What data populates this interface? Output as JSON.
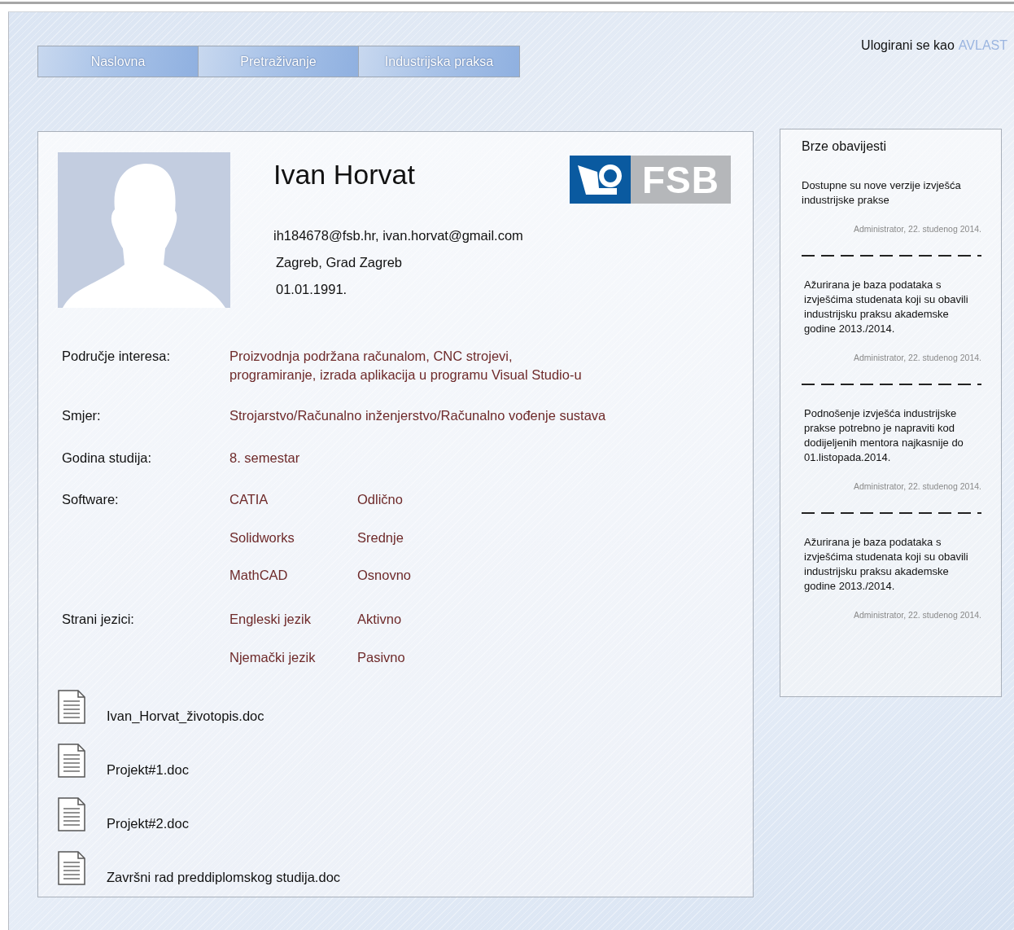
{
  "nav": {
    "tabs": [
      {
        "label": "Naslovna"
      },
      {
        "label": "Pretraživanje"
      },
      {
        "label": "Industrijska praksa"
      }
    ]
  },
  "login": {
    "prefix": "Ulogirani se kao",
    "user": "AVLAST"
  },
  "profile": {
    "name": "Ivan Horvat",
    "logo": "FSB",
    "contacts": [
      "ih184678@fsb.hr, ivan.horvat@gmail.com",
      "Zagreb, Grad Zagreb",
      "01.01.1991."
    ],
    "fields": [
      {
        "label": "Područje interesa:",
        "kind": "text",
        "value": "Proizvodnja podržana računalom, CNC strojevi,\nprogramiranje, izrada aplikacija u programu Visual Studio-u"
      },
      {
        "label": "Smjer:",
        "kind": "text",
        "value": "Strojarstvo/Računalno inženjerstvo/Računalno vođenje sustava"
      },
      {
        "label": "Godina studija:",
        "kind": "text",
        "value": "8. semestar"
      },
      {
        "label": "Software:",
        "kind": "pairs",
        "items": [
          {
            "name": "CATIA",
            "rating": "Odlično"
          },
          {
            "name": "Solidworks",
            "rating": "Srednje"
          },
          {
            "name": "MathCAD",
            "rating": "Osnovno"
          }
        ]
      },
      {
        "label": "Strani jezici:",
        "kind": "pairs",
        "items": [
          {
            "name": "Engleski jezik",
            "rating": "Aktivno"
          },
          {
            "name": "Njemački jezik",
            "rating": "Pasivno"
          }
        ]
      }
    ],
    "documents": [
      "Ivan_Horvat_životopis.doc",
      "Projekt#1.doc",
      "Projekt#2.doc",
      "Završni rad preddiplomskog studija.doc"
    ]
  },
  "news": {
    "title": "Brze obavijesti",
    "items": [
      {
        "text": "Dostupne su nove verzije izvješća industrijske prakse",
        "meta": "Administrator, 22. studenog 2014."
      },
      {
        "text": "Ažurirana je baza podataka s izvješćima studenata koji su obavili industrijsku praksu akademske godine 2013./2014.",
        "meta": "Administrator, 22. studenog 2014."
      },
      {
        "text": "Podnošenje izvješća industrijske prakse potrebno je napraviti kod dodijeljenih mentora najkasnije do 01.listopada.2014.",
        "meta": "Administrator, 22. studenog 2014."
      },
      {
        "text": "Ažurirana je baza podataka s izvješćima studenata koji su obavili industrijsku praksu akademske godine 2013./2014.",
        "meta": "Administrator, 22. studenog 2014."
      }
    ]
  }
}
